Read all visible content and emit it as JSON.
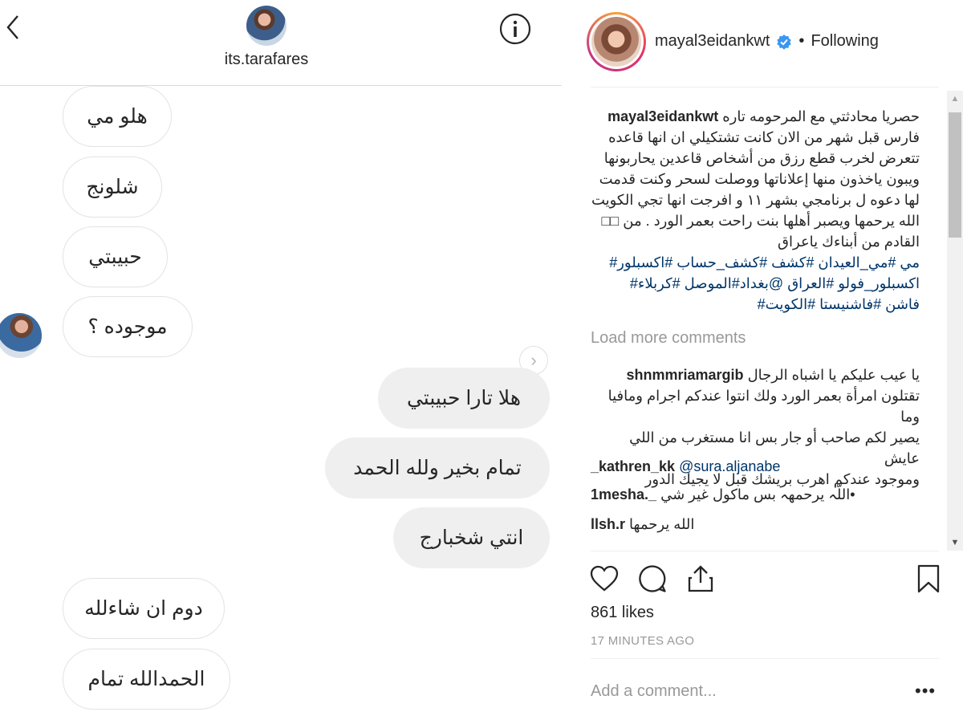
{
  "dm": {
    "username": "its.tarafares",
    "received_top": [
      {
        "text": "هلو مي"
      },
      {
        "text": "شلونج"
      },
      {
        "text": "حبيبتي"
      },
      {
        "text": "موجوده ؟"
      }
    ],
    "sent": [
      {
        "text": "هلا تارا حبيبتي"
      },
      {
        "text": "تمام بخير ولله الحمد"
      },
      {
        "text": "انتي شخبارج"
      }
    ],
    "received_bottom": [
      {
        "text": "دوم ان شاءلله"
      },
      {
        "text": "الحمدالله تمام"
      }
    ],
    "icons": {
      "back": "chevron-left-icon",
      "info": "info-icon",
      "next": "chevron-right-icon"
    }
  },
  "post": {
    "username": "mayal3eidankwt",
    "follow_status": "Following",
    "verified": true,
    "caption": {
      "user": "mayal3eidankwt",
      "lines": [
        "حصريا محادثتي مع المرحومه تاره",
        "فارس قبل شهر من الان كانت تشتكيلي ان انها قاعده",
        "تتعرض لخرب قطع رزق من أشخاص قاعدين يحاربونها",
        "ويبون ياخذون منها إعلاناتها ووصلت لسحر وكنت قدمت",
        "لها دعوه ل برنامجي بشهر ١١ و افرجت انها تجي الكويت",
        "الله يرحمها ويصبر أهلها بنت راحت بعمر الورد . من □□",
        "القادم من أبناءك ياعراق"
      ],
      "hashtag_lines": [
        "مي #مي_العيدان #كشف #كشف_حساب #اكسبلور#",
        "اكسبلور_فولو #العراق @بغداد#الموصل #كربلاء#",
        "فاشن #فاشنيستا #الكويت#"
      ]
    },
    "load_more": "Load more comments",
    "comments": [
      {
        "user": "shnmmriamargib",
        "lines": [
          "يا عيب عليكم يا اشباه الرجال",
          "تقتلون امرأة بعمر الورد ولك انتوا عندكم اجرام ومافيا وما",
          "يصير لكم صاحب أو جار بس انا مستغرب من اللي عايش",
          "وموجود عندكم اهرب بريشك قبل لا يجيك الدور"
        ]
      },
      {
        "user": "_kathren_kk",
        "mention": "@sura.aljanabe"
      },
      {
        "user": "1mesha._",
        "text": "اللّہ يرحمهہ بس ماكول غير شي•"
      },
      {
        "user": "llsh.r",
        "text": "الله يرحمها"
      }
    ],
    "likes": "861 likes",
    "timestamp": "17 MINUTES AGO",
    "add_comment_placeholder": "Add a comment...",
    "more_options": "•••",
    "icons": {
      "like": "heart-icon",
      "comment": "comment-icon",
      "share": "share-icon",
      "save": "bookmark-icon",
      "verified": "verified-badge-icon"
    },
    "colors": {
      "link": "#003569",
      "verified": "#3897f0",
      "muted": "#999999"
    }
  }
}
